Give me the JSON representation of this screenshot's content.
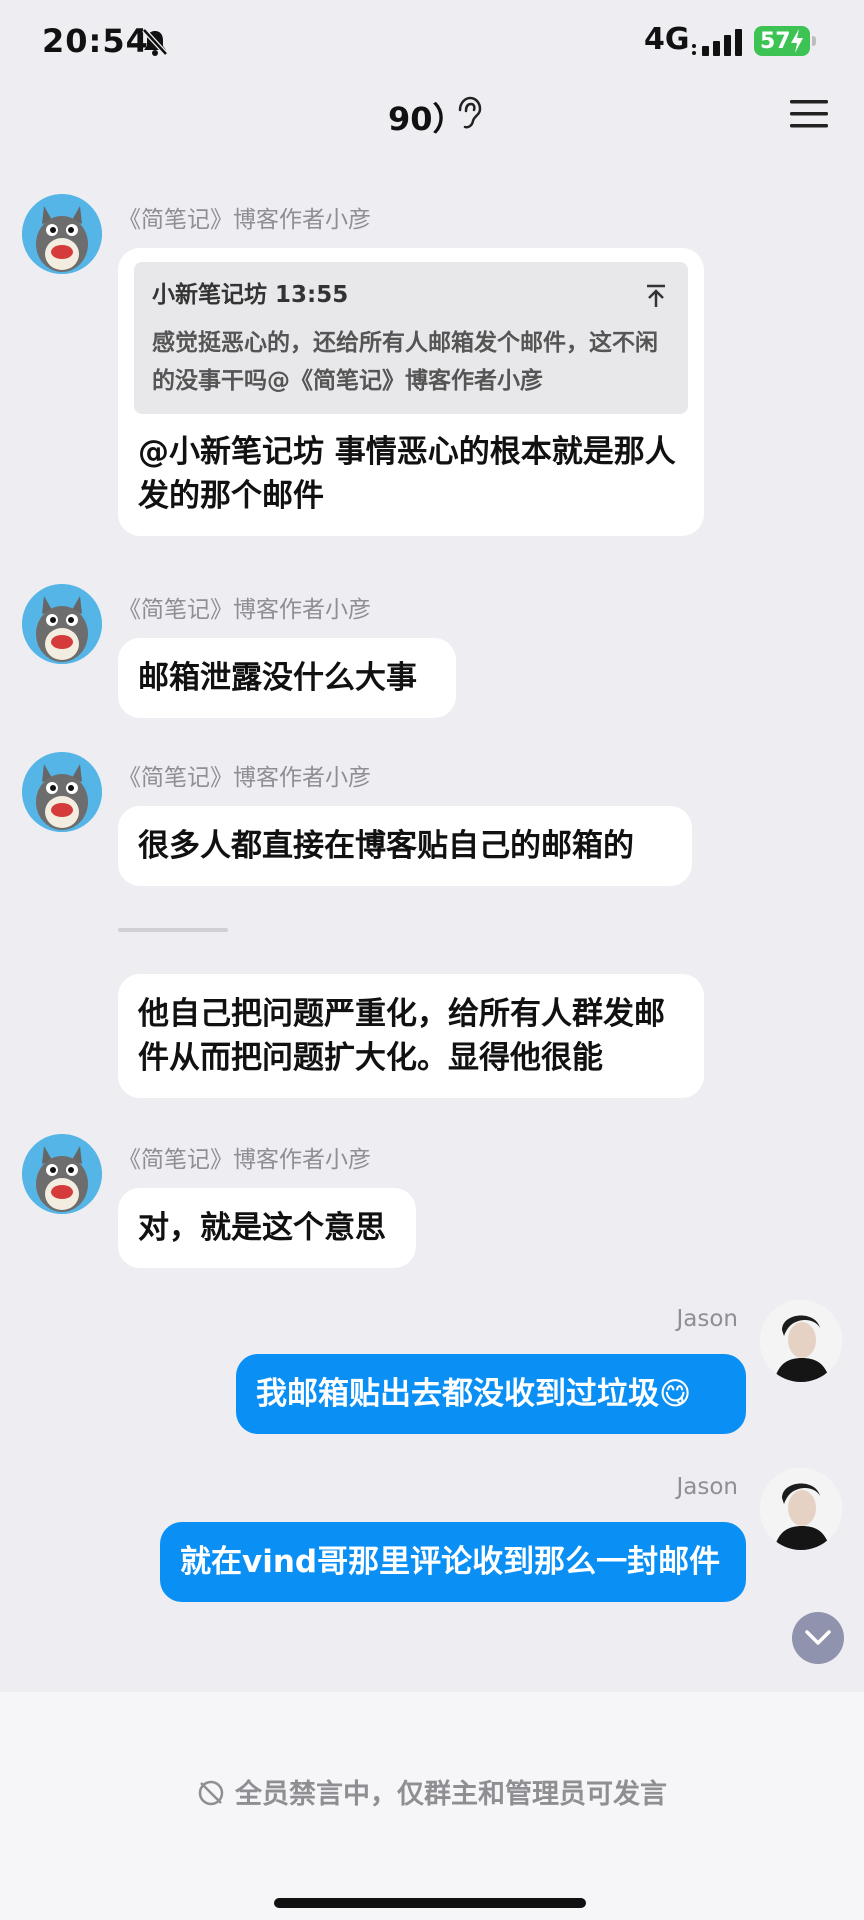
{
  "status_bar": {
    "time": "20:54",
    "network": "4G",
    "battery": "57"
  },
  "header": {
    "title": "90）"
  },
  "messages": [
    {
      "sender": "《简笔记》博客作者小彦",
      "quote": {
        "author_time": "小新笔记坊 13:55",
        "text": "感觉挺恶心的，还给所有人邮箱发个邮件，这不闲的没事干吗@《简笔记》博客作者小彦"
      },
      "text": "@小新笔记坊 事情恶心的根本就是那人发的那个邮件"
    },
    {
      "sender": "《简笔记》博客作者小彦",
      "text": "邮箱泄露没什么大事"
    },
    {
      "sender": "《简笔记》博客作者小彦",
      "text": "很多人都直接在博客贴自己的邮箱的"
    },
    {
      "text": "他自己把问题严重化，给所有人群发邮件从而把问题扩大化。显得他很能"
    },
    {
      "sender": "《简笔记》博客作者小彦",
      "text": "对，就是这个意思"
    },
    {
      "sender": "Jason",
      "text": "我邮箱贴出去都没收到过垃圾😋"
    },
    {
      "sender": "Jason",
      "text": "就在vind哥那里评论收到那么一封邮件"
    }
  ],
  "footer": {
    "mute_notice": "全员禁言中，仅群主和管理员可发言"
  },
  "colors": {
    "outgoing_bubble": "#0a8ff5",
    "incoming_bubble": "#ffffff",
    "background": "#eeeef2"
  }
}
